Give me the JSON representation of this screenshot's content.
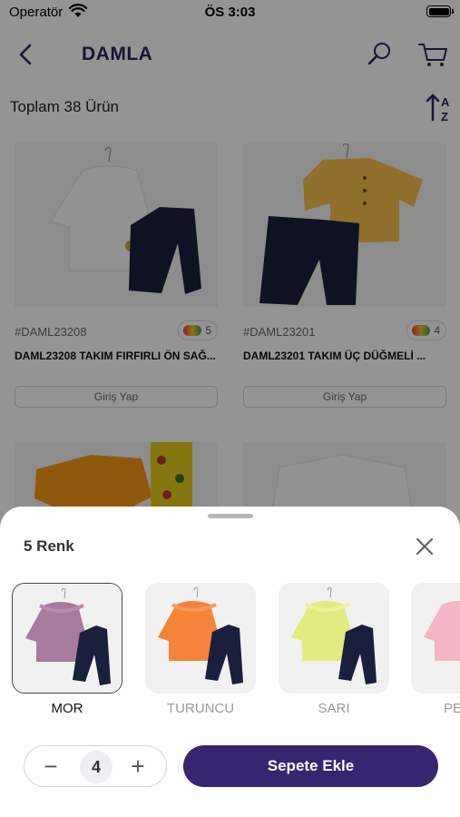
{
  "status_bar": {
    "carrier": "Operatör",
    "time": "ÖS 3:03"
  },
  "header": {
    "title": "DAMLA"
  },
  "listing": {
    "summary": "Toplam 38 Ürün"
  },
  "products": [
    {
      "code": "#DAML23208",
      "color_count": "5",
      "name": "DAML23208 TAKIM FIRFIRLI ÖN SAĞ...",
      "action": "Giriş Yap"
    },
    {
      "code": "#DAML23201",
      "color_count": "4",
      "name": "DAML23201 TAKIM ÜÇ DÜĞMELİ ...",
      "action": "Giriş Yap"
    }
  ],
  "sheet": {
    "heading": "5 Renk",
    "swatches": [
      {
        "label": "MOR",
        "color": "#a77a9f",
        "selected": true
      },
      {
        "label": "TURUNCU",
        "color": "#f5843a",
        "selected": false
      },
      {
        "label": "SARI",
        "color": "#e3ea7f",
        "selected": false
      },
      {
        "label": "PE",
        "color": "#f4b6c4",
        "selected": false
      }
    ],
    "quantity": "4",
    "minus_label": "−",
    "plus_label": "+",
    "add_button": "Sepete Ekle"
  },
  "colors": {
    "brand": "#382570",
    "title": "#2e2460"
  }
}
